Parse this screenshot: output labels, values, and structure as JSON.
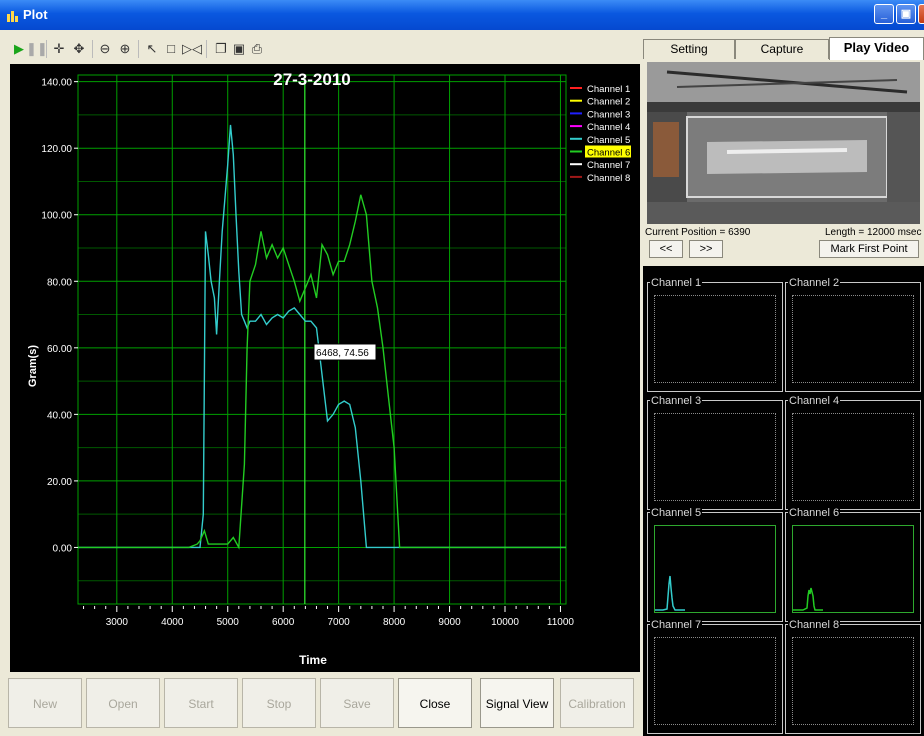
{
  "window": {
    "title": "Plot"
  },
  "bottom_buttons": [
    "New",
    "Open",
    "Start",
    "Stop",
    "Save",
    "Close",
    "Signal View",
    "Calibration"
  ],
  "tabs": {
    "setting": "Setting",
    "capture": "Capture",
    "play_video": "Play Video"
  },
  "video": {
    "current_position": "Current Position = 6390",
    "length": "Length = 12000 msec",
    "prev_label": "<<",
    "next_label": ">>",
    "mark_first_point": "Mark First Point"
  },
  "channels": [
    "Channel 1",
    "Channel 2",
    "Channel 3",
    "Channel 4",
    "Channel 5",
    "Channel 6",
    "Channel 7",
    "Channel 8"
  ],
  "colors": {
    "plot_bg": "#000000",
    "grid": "#00a000",
    "channel_5": "#33cccc",
    "channel_6": "#22bb33"
  },
  "chart_data": {
    "type": "line",
    "title": "27-3-2010",
    "xlabel": "Time",
    "ylabel": "Gram(s)",
    "xlim": [
      2300,
      11100
    ],
    "ylim": [
      -17,
      142
    ],
    "xticks": [
      3000,
      4000,
      5000,
      6000,
      7000,
      8000,
      9000,
      10000,
      11000
    ],
    "yticks": [
      "0.00",
      "20.00",
      "40.00",
      "60.00",
      "80.00",
      "100.00",
      "120.00",
      "140.00"
    ],
    "grid": true,
    "legend_position": "top-right",
    "highlighted_legend": "Channel 6",
    "legend": [
      {
        "name": "Channel 1",
        "color": "#ff2020"
      },
      {
        "name": "Channel 2",
        "color": "#ffff00"
      },
      {
        "name": "Channel 3",
        "color": "#2020ff"
      },
      {
        "name": "Channel 4",
        "color": "#ff00ff"
      },
      {
        "name": "Channel 5",
        "color": "#33cccc"
      },
      {
        "name": "Channel 6",
        "color": "#22cc22"
      },
      {
        "name": "Channel 7",
        "color": "#ffffff"
      },
      {
        "name": "Channel 8",
        "color": "#a01818"
      }
    ],
    "tooltip": {
      "x": 6468,
      "y": 74.56,
      "text": "6468, 74.56"
    },
    "cursor_x": 6390,
    "series": [
      {
        "name": "Channel 5",
        "color": "#33cccc",
        "points": [
          [
            2300,
            0
          ],
          [
            4000,
            0
          ],
          [
            4500,
            0
          ],
          [
            4560,
            10
          ],
          [
            4600,
            95
          ],
          [
            4650,
            88
          ],
          [
            4700,
            80
          ],
          [
            4760,
            75
          ],
          [
            4800,
            64
          ],
          [
            4850,
            80
          ],
          [
            4900,
            95
          ],
          [
            5000,
            115
          ],
          [
            5050,
            127
          ],
          [
            5100,
            118
          ],
          [
            5150,
            100
          ],
          [
            5200,
            83
          ],
          [
            5250,
            70
          ],
          [
            5300,
            68
          ],
          [
            5350,
            66
          ],
          [
            5400,
            68
          ],
          [
            5500,
            68
          ],
          [
            5600,
            70
          ],
          [
            5700,
            67
          ],
          [
            5800,
            69
          ],
          [
            5900,
            70
          ],
          [
            6000,
            69
          ],
          [
            6100,
            71
          ],
          [
            6200,
            72
          ],
          [
            6300,
            70
          ],
          [
            6400,
            68
          ],
          [
            6500,
            68
          ],
          [
            6600,
            66
          ],
          [
            6700,
            52
          ],
          [
            6800,
            38
          ],
          [
            6900,
            40
          ],
          [
            7000,
            43
          ],
          [
            7100,
            44
          ],
          [
            7200,
            43
          ],
          [
            7300,
            36
          ],
          [
            7400,
            20
          ],
          [
            7500,
            0
          ],
          [
            8000,
            0
          ],
          [
            11100,
            0
          ]
        ]
      },
      {
        "name": "Channel 6",
        "color": "#22cc22",
        "points": [
          [
            2300,
            0
          ],
          [
            4000,
            0
          ],
          [
            4300,
            0
          ],
          [
            4450,
            1
          ],
          [
            4500,
            2
          ],
          [
            4580,
            5
          ],
          [
            4650,
            1
          ],
          [
            5000,
            1
          ],
          [
            5100,
            3
          ],
          [
            5200,
            0
          ],
          [
            5300,
            25
          ],
          [
            5350,
            60
          ],
          [
            5400,
            80
          ],
          [
            5500,
            85
          ],
          [
            5600,
            95
          ],
          [
            5700,
            87
          ],
          [
            5800,
            91
          ],
          [
            5900,
            87
          ],
          [
            6000,
            90
          ],
          [
            6100,
            85
          ],
          [
            6200,
            80
          ],
          [
            6300,
            74
          ],
          [
            6400,
            78
          ],
          [
            6500,
            82
          ],
          [
            6600,
            75
          ],
          [
            6700,
            91
          ],
          [
            6800,
            88
          ],
          [
            6900,
            82
          ],
          [
            7000,
            86
          ],
          [
            7100,
            86
          ],
          [
            7200,
            91
          ],
          [
            7300,
            98
          ],
          [
            7400,
            106
          ],
          [
            7500,
            100
          ],
          [
            7600,
            80
          ],
          [
            7700,
            72
          ],
          [
            7800,
            60
          ],
          [
            7900,
            45
          ],
          [
            8000,
            30
          ],
          [
            8100,
            0
          ],
          [
            8300,
            0
          ],
          [
            11100,
            0
          ]
        ]
      }
    ]
  }
}
